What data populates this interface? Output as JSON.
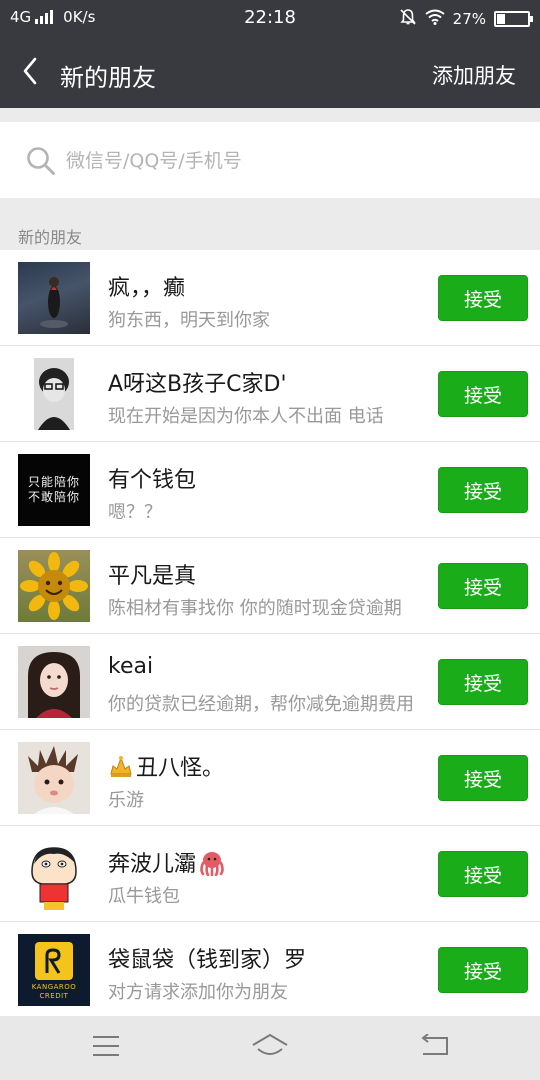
{
  "status_bar": {
    "network": "4G",
    "speed": "0K/s",
    "time": "22:18",
    "battery": "27%",
    "battery_level": 0.27
  },
  "nav": {
    "title": "新的朋友",
    "action": "添加朋友"
  },
  "search": {
    "placeholder": "微信号/QQ号/手机号"
  },
  "section": {
    "title": "新的朋友"
  },
  "requests": [
    {
      "name": "疯，，癫",
      "message": "狗东西，明天到你家",
      "action": "接受"
    },
    {
      "name": "A呀这B孩子C家D'",
      "message": "现在开始是因为你本人不出面 电话",
      "action": "接受"
    },
    {
      "name": "有个钱包",
      "message": "嗯？？",
      "action": "接受"
    },
    {
      "name": "平凡是真",
      "message": "陈相材有事找你 你的随时现金贷逾期",
      "action": "接受"
    },
    {
      "name": "keai",
      "message": "你的贷款已经逾期，帮你减免逾期费用",
      "action": "接受"
    },
    {
      "name": "丑八怪。",
      "message": "乐游",
      "action": "接受"
    },
    {
      "name": "奔波儿灞",
      "message": "瓜牛钱包",
      "action": "接受"
    },
    {
      "name": "袋鼠袋（钱到家）罗",
      "message": "对方请求添加你为朋友",
      "action": "接受"
    }
  ],
  "avatar_texts": {
    "wallet_line1": "只能陪你",
    "wallet_line2": "不敢陪你",
    "kangaroo_line1": "KANGAROO",
    "kangaroo_line2": "CREDIT"
  },
  "colors": {
    "nav_bg": "#393a3f",
    "accept_green": "#1aad19",
    "page_bg": "#ebebeb"
  },
  "icons": {
    "back": "chevron-left-icon",
    "search": "search-icon",
    "mute": "bell-off-icon",
    "wifi": "wifi-icon",
    "menu": "menu-icon",
    "home": "home-icon",
    "return": "return-icon"
  }
}
